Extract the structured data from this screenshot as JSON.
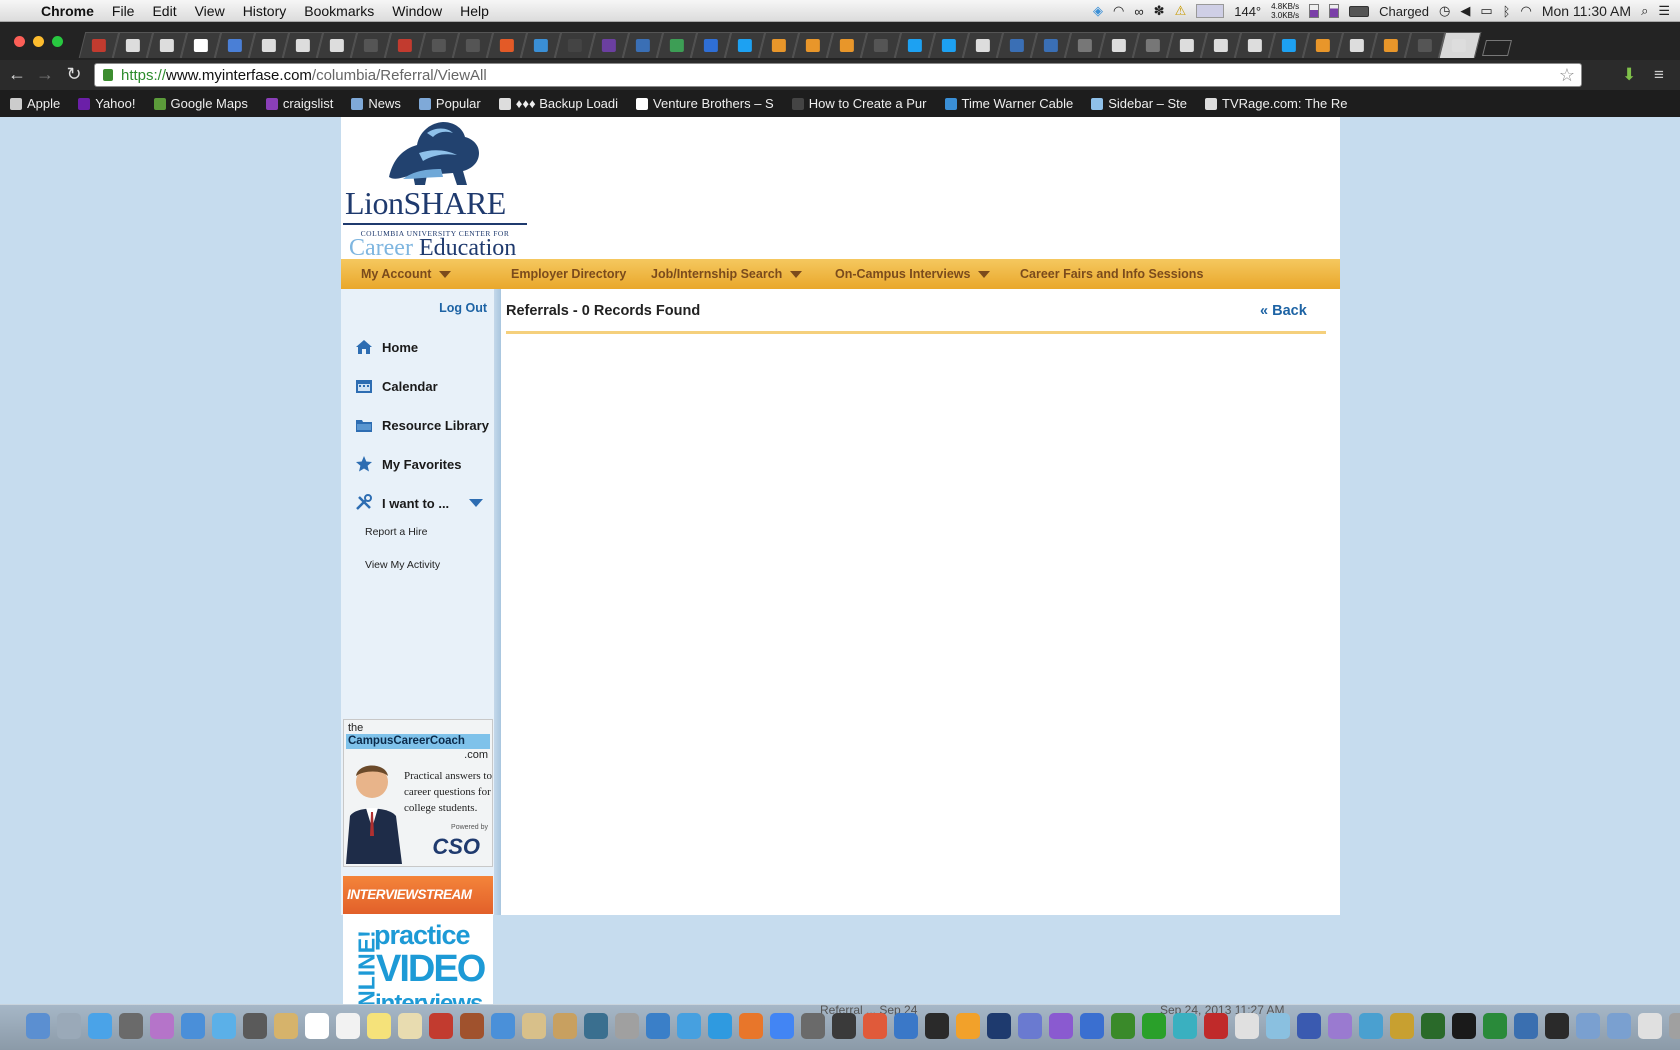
{
  "menubar": {
    "app_name": "Chrome",
    "items": [
      "File",
      "Edit",
      "View",
      "History",
      "Bookmarks",
      "Window",
      "Help"
    ],
    "temperature": "144°",
    "net_up": "4.8KB/s",
    "net_down": "3.0KB/s",
    "battery": "Charged",
    "clock": "Mon 11:30 AM"
  },
  "browser": {
    "url_scheme": "https://",
    "url_host": "www.myinterfase.com",
    "url_path": "/columbia/Referral/ViewAll",
    "tab_favicon_colors": [
      "#c23b2f",
      "#dddddd",
      "#dddddd",
      "#ffffff",
      "#4a7fd6",
      "#dddddd",
      "#dddddd",
      "#dddddd",
      "#555555",
      "#c23b2f",
      "#555555",
      "#555555",
      "#e35a27",
      "#3a8fd6",
      "#444444",
      "#6b3fa0",
      "#3a6fb5",
      "#3d9e55",
      "#2f6fd6",
      "#1da1f2",
      "#e8962a",
      "#e8962a",
      "#e8962a",
      "#555555",
      "#1da1f2",
      "#1da1f2",
      "#dddddd",
      "#3a6fb5",
      "#3a6fb5",
      "#777777",
      "#dddddd",
      "#777777",
      "#dddddd",
      "#dddddd",
      "#dddddd",
      "#1da1f2",
      "#e8962a",
      "#dddddd",
      "#e8962a",
      "#555555",
      "#dddddd"
    ]
  },
  "bookmarks": [
    {
      "label": "Apple",
      "color": "#cccccc"
    },
    {
      "label": "Yahoo!",
      "color": "#6b1fa8"
    },
    {
      "label": "Google Maps",
      "color": "#5b9b3a"
    },
    {
      "label": "craigslist",
      "color": "#8a3fb8"
    },
    {
      "label": "News",
      "color": "#7fa9d8"
    },
    {
      "label": "Popular",
      "color": "#7fa9d8"
    },
    {
      "label": "♦♦♦ Backup Loadi",
      "color": "#dddddd"
    },
    {
      "label": "Venture Brothers – S",
      "color": "#ffffff"
    },
    {
      "label": "How to Create a Pur",
      "color": "#444444"
    },
    {
      "label": "Time Warner Cable",
      "color": "#3a8fd6"
    },
    {
      "label": "Sidebar – Ste",
      "color": "#8fc1ea"
    },
    {
      "label": "TVRage.com: The Re",
      "color": "#dddddd"
    }
  ],
  "site": {
    "logo": {
      "brand": "LionSHARE",
      "subtitle": "COLUMBIA UNIVERSITY CENTER FOR",
      "career": "Career",
      "education": "Education"
    },
    "nav": {
      "my_account": "My Account",
      "employer_directory": "Employer Directory",
      "job_search": "Job/Internship Search",
      "on_campus": "On-Campus Interviews",
      "career_fairs": "Career Fairs and Info Sessions"
    },
    "sidebar": {
      "logout": "Log Out",
      "home": "Home",
      "calendar": "Calendar",
      "resource_library": "Resource Library",
      "my_favorites": "My Favorites",
      "i_want_to": "I want to ...",
      "report_hire": "Report a Hire",
      "view_activity": "View My Activity"
    },
    "ad_coach": {
      "the": "the",
      "name": "CampusCareerCoach",
      "dotcom": ".com",
      "tagline1": "Practical answers to",
      "tagline2": "career questions for",
      "tagline3": "college students.",
      "powered": "Powered by",
      "cso": "CSO"
    },
    "ad_interview": {
      "header": "INTERVIEWSTREAM",
      "online": "ONLINE!",
      "practice": "practice",
      "video": "VIDEO",
      "interviews": "interviews"
    },
    "content": {
      "title": "Referrals - 0 Records Found",
      "back": "« Back"
    }
  },
  "dock": {
    "ghost_text_1": "Referral ... Sep 24",
    "ghost_text_2": "Sep 24, 2013 11:27 AM",
    "icon_colors": [
      "#5b8fd1",
      "#9aa9b8",
      "#4aa3e8",
      "#6a6a6a",
      "#b574c9",
      "#4a8fd9",
      "#5bb0e8",
      "#5a5a5a",
      "#d6b36b",
      "#ffffff",
      "#f2f2f2",
      "#f5e27a",
      "#e8dcb0",
      "#c23b2f",
      "#a0522d",
      "#4a90d9",
      "#d8c08a",
      "#c8a060",
      "#3a6f8f",
      "#a0a0a0",
      "#3a7fc8",
      "#46a0e0",
      "#2f9ae0",
      "#e8762a",
      "#4285f4",
      "#6a6a6a",
      "#3a3a3a",
      "#e05a3a",
      "#3a78c8",
      "#2a2a2a",
      "#f2a12a",
      "#1e3a6e",
      "#6a7ad0",
      "#8a5ad0",
      "#3a6fd0",
      "#3a8a2a",
      "#2aa02a",
      "#3ab0c0",
      "#c02a2a",
      "#e0e0e0",
      "#8ac0e0",
      "#3a5ab0",
      "#9a7ad0",
      "#4aa0d0",
      "#c8a030",
      "#2a6a2a",
      "#1a1a1a",
      "#2a8a3a",
      "#3a6fb0",
      "#2a2a2a",
      "#7aa0d0",
      "#7aa0d0",
      "#e0e0e0",
      "#a0a0a0"
    ]
  }
}
